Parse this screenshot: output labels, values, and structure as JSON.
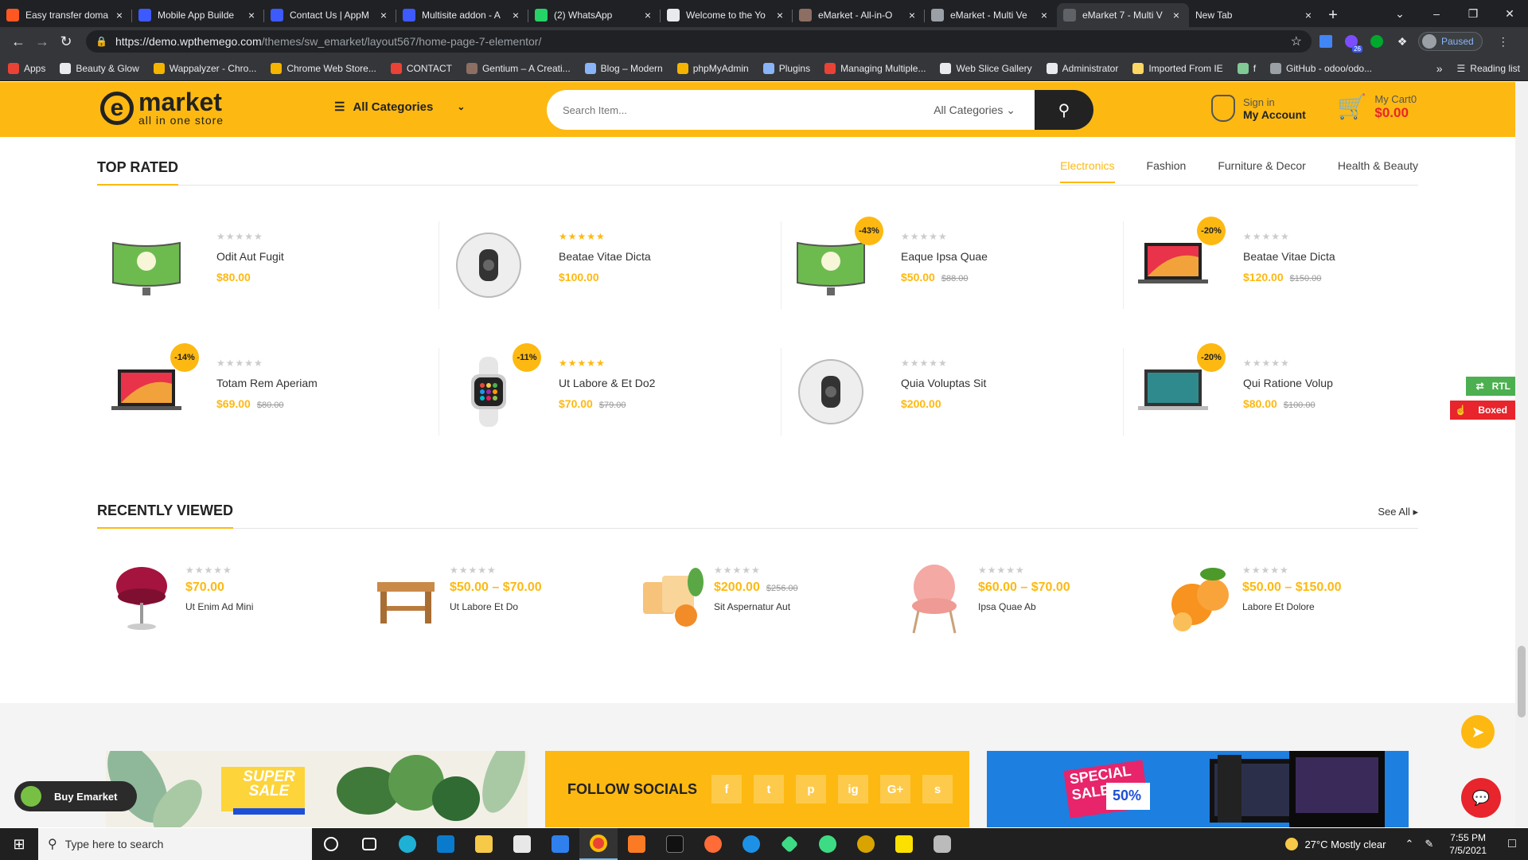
{
  "browser": {
    "tabs": [
      {
        "title": "Easy transfer doma",
        "icon": "orange-n-icon",
        "color": "#ff5722"
      },
      {
        "title": "Mobile App Builde",
        "icon": "appmysite-icon",
        "color": "#3d5afe"
      },
      {
        "title": "Contact Us | AppM",
        "icon": "appmysite-icon",
        "color": "#3d5afe"
      },
      {
        "title": "Multisite addon - A",
        "icon": "appmysite-icon",
        "color": "#3d5afe"
      },
      {
        "title": "(2) WhatsApp",
        "icon": "whatsapp-icon",
        "color": "#25d366"
      },
      {
        "title": "Welcome to the Yo",
        "icon": "wordpress-icon",
        "color": "#e8eaed"
      },
      {
        "title": "eMarket - All-in-O",
        "icon": "themeforest-icon",
        "color": "#8d6e63"
      },
      {
        "title": "eMarket - Multi Ve",
        "icon": "wordpress-icon",
        "color": "#9aa0a6"
      },
      {
        "title": "eMarket 7 - Multi V",
        "icon": "loading-icon",
        "color": "#5f6368"
      },
      {
        "title": "New Tab",
        "icon": "none",
        "color": "#202124"
      }
    ],
    "url_host": "https://demo.wpthemego.com",
    "url_path": "/themes/sw_emarket/layout567/home-page-7-elementor/",
    "profile_label": "Paused",
    "ext_badge": "26",
    "bookmarks": [
      {
        "label": "Apps",
        "color": "#ea4335"
      },
      {
        "label": "Beauty & Glow",
        "color": "#e8eaed"
      },
      {
        "label": "Wappalyzer - Chro...",
        "color": "#f4b400"
      },
      {
        "label": "Chrome Web Store...",
        "color": "#f4b400"
      },
      {
        "label": "CONTACT",
        "color": "#ea4335"
      },
      {
        "label": "Gentium – A Creati...",
        "color": "#8d6e63"
      },
      {
        "label": "Blog – Modern",
        "color": "#8ab4f8"
      },
      {
        "label": "phpMyAdmin",
        "color": "#f4b400"
      },
      {
        "label": "Plugins",
        "color": "#8ab4f8"
      },
      {
        "label": "Managing Multiple...",
        "color": "#ea4335"
      },
      {
        "label": "Web Slice Gallery",
        "color": "#e8eaed"
      },
      {
        "label": "Administrator",
        "color": "#e8eaed"
      },
      {
        "label": "Imported From IE",
        "color": "#fdd663"
      },
      {
        "label": "f",
        "color": "#81c995"
      },
      {
        "label": "GitHub - odoo/odo...",
        "color": "#9aa0a6"
      }
    ],
    "reading_list": "Reading list",
    "more_bookmarks": "»"
  },
  "site": {
    "logo_name": "market",
    "logo_letter": "e",
    "logo_tagline": "all in one store",
    "all_categories": "All Categories",
    "search_placeholder": "Search Item...",
    "search_category": "All Categories",
    "signin": "Sign in",
    "my_account": "My Account",
    "cart_label": "My Cart0",
    "cart_total": "$0.00"
  },
  "top_rated": {
    "title": "TOP RATED",
    "tabs": [
      "Electronics",
      "Fashion",
      "Furniture & Decor",
      "Health & Beauty"
    ],
    "products": [
      {
        "name": "Odit Aut Fugit",
        "price": "$80.00",
        "old": "",
        "badge": "",
        "rated": false,
        "image": "curved-tv"
      },
      {
        "name": "Beatae Vitae Dicta",
        "price": "$100.00",
        "old": "",
        "badge": "",
        "rated": true,
        "image": "speaker"
      },
      {
        "name": "Eaque Ipsa Quae",
        "price": "$50.00",
        "old": "$88.00",
        "badge": "-43%",
        "rated": false,
        "image": "curved-tv"
      },
      {
        "name": "Beatae Vitae Dicta",
        "price": "$120.00",
        "old": "$150.00",
        "badge": "-20%",
        "rated": false,
        "image": "laptop"
      },
      {
        "name": "Totam Rem Aperiam",
        "price": "$69.00",
        "old": "$80.00",
        "badge": "-14%",
        "rated": false,
        "image": "laptop"
      },
      {
        "name": "Ut Labore & Et Do2",
        "price": "$70.00",
        "old": "$79.00",
        "badge": "-11%",
        "rated": true,
        "image": "watch"
      },
      {
        "name": "Quia Voluptas Sit",
        "price": "$200.00",
        "old": "",
        "badge": "",
        "rated": false,
        "image": "speaker"
      },
      {
        "name": "Qui Ratione Volup",
        "price": "$80.00",
        "old": "$100.00",
        "badge": "-20%",
        "rated": false,
        "image": "macbook"
      }
    ]
  },
  "recently_viewed": {
    "title": "RECENTLY VIEWED",
    "see_all": "See All",
    "items": [
      {
        "name": "Ut Enim Ad Mini",
        "price": "$70.00",
        "old": "",
        "image": "chair"
      },
      {
        "name": "Ut Labore Et Do",
        "price": "$50.00 – $70.00",
        "old": "",
        "image": "stool"
      },
      {
        "name": "Sit Aspernatur Aut",
        "price": "$200.00",
        "old": "$256.00",
        "image": "spa"
      },
      {
        "name": "Ipsa Quae Ab",
        "price": "$60.00 – $70.00",
        "old": "",
        "image": "pink-chair"
      },
      {
        "name": "Labore Et Dolore",
        "price": "$50.00 – $150.00",
        "old": "",
        "image": "orange"
      }
    ]
  },
  "footer": {
    "banner1_text1": "SUPER",
    "banner1_text2": "SALE",
    "follow_title": "FOLLOW SOCIALS",
    "socials": [
      "f",
      "t",
      "p",
      "ig",
      "G+",
      "s"
    ],
    "banner3_text1": "SPECIAL",
    "banner3_text2": "SALE",
    "banner3_text3": "50%"
  },
  "floating": {
    "rtl": "RTL",
    "boxed": "Boxed",
    "buy": "Buy Emarket"
  },
  "taskbar": {
    "search_placeholder": "Type here to search",
    "weather": "27°C  Mostly clear",
    "time": "7:55 PM",
    "date": "7/5/2021"
  },
  "colors": {
    "accent": "#fdb911",
    "sale_red": "#e8242c"
  }
}
